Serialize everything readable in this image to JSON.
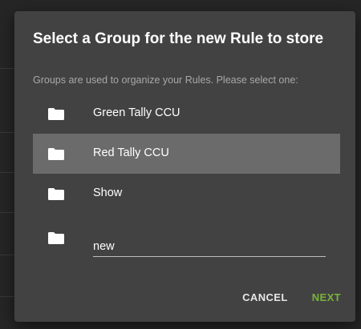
{
  "dialog": {
    "title": "Select a Group for the new Rule to store",
    "subtitle": "Groups are used to organize your Rules. Please select one:",
    "groups": [
      {
        "label": "Green Tally CCU",
        "icon": "folder-icon",
        "selected": false
      },
      {
        "label": "Red Tally CCU",
        "icon": "folder-icon",
        "selected": true
      },
      {
        "label": "Show",
        "icon": "folder-icon",
        "selected": false
      }
    ],
    "new_group": {
      "icon": "folder-icon",
      "value": "new"
    },
    "actions": {
      "cancel_label": "CANCEL",
      "next_label": "NEXT"
    }
  },
  "colors": {
    "dialog_bg": "#424242",
    "selected_row": "#6b6b6b",
    "accent_next": "#79b33a",
    "text_primary": "#ffffff",
    "text_secondary": "#a8a8a8"
  }
}
